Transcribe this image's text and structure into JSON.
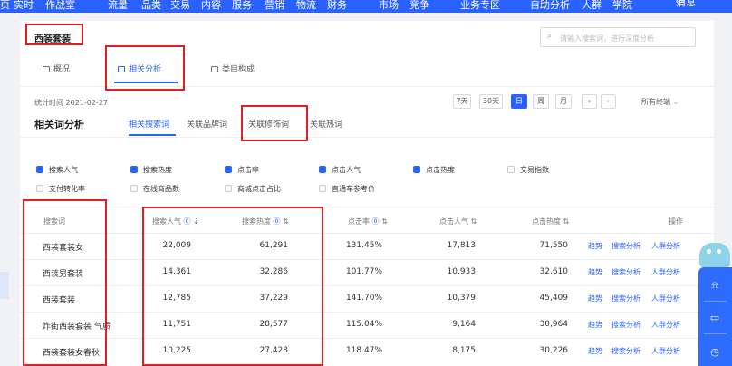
{
  "topnav": {
    "items": [
      "页",
      "实时",
      "作战室",
      "流量",
      "品类",
      "交易",
      "内容",
      "服务",
      "营销",
      "物流",
      "财务",
      "市场",
      "竞争",
      "业务专区",
      "自助分析",
      "人群",
      "学院"
    ],
    "messages": "消息"
  },
  "page": {
    "title": "西装套装",
    "search_placeholder": "请输入搜索词，进行深度分析",
    "tabs": [
      "概况",
      "相关分析",
      "类目构成"
    ],
    "stats_time": "统计时间 2021-02-27",
    "range_buttons": [
      "7天",
      "30天",
      "日",
      "周",
      "月"
    ],
    "terminal_select": "所有终端",
    "section_title": "相关词分析",
    "sub_tabs": [
      "相关搜索词",
      "关联品牌词",
      "关联修饰词",
      "关联热词"
    ]
  },
  "metrics": {
    "row1": [
      {
        "label": "搜索人气",
        "checked": true
      },
      {
        "label": "搜索热度",
        "checked": true
      },
      {
        "label": "点击率",
        "checked": true
      },
      {
        "label": "点击人气",
        "checked": true
      },
      {
        "label": "点击热度",
        "checked": true
      },
      {
        "label": "交易指数",
        "checked": false
      }
    ],
    "row2": [
      {
        "label": "支付转化率",
        "checked": false
      },
      {
        "label": "在线商品数",
        "checked": false
      },
      {
        "label": "商城点击占比",
        "checked": false
      },
      {
        "label": "直通车参考价",
        "checked": false
      }
    ]
  },
  "table": {
    "headers": [
      "搜索词",
      "搜索人气",
      "搜索热度",
      "点击率",
      "点击人气",
      "点击热度",
      "操作"
    ],
    "rows": [
      [
        "西装套装女",
        "22,009",
        "61,291",
        "131.45%",
        "17,813",
        "71,550"
      ],
      [
        "西装男套装",
        "14,361",
        "32,286",
        "101.77%",
        "10,933",
        "32,610"
      ],
      [
        "西装套装",
        "12,785",
        "37,229",
        "141.70%",
        "10,379",
        "45,409"
      ],
      [
        "炸街西装套装 气质",
        "11,751",
        "28,577",
        "115.04%",
        "9,164",
        "30,964"
      ],
      [
        "西装套装女春秋",
        "10,225",
        "27,428",
        "118.47%",
        "8,175",
        "30,226"
      ]
    ],
    "actions": [
      "趋势",
      "搜索分析",
      "人群分析"
    ]
  },
  "colors": {
    "accent": "#2962ff",
    "highlight": "#e02020"
  }
}
